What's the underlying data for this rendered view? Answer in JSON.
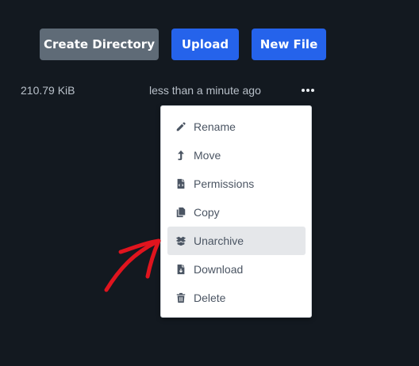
{
  "toolbar": {
    "create_directory": "Create Directory",
    "upload": "Upload",
    "new_file": "New File"
  },
  "file_row": {
    "size": "210.79 KiB",
    "modified": "less than a minute ago"
  },
  "context_menu": {
    "items": [
      {
        "label": "Rename",
        "icon": "pencil-icon"
      },
      {
        "label": "Move",
        "icon": "level-up-icon"
      },
      {
        "label": "Permissions",
        "icon": "file-code-icon"
      },
      {
        "label": "Copy",
        "icon": "copy-icon"
      },
      {
        "label": "Unarchive",
        "icon": "box-open-icon",
        "highlighted": true
      },
      {
        "label": "Download",
        "icon": "file-download-icon"
      },
      {
        "label": "Delete",
        "icon": "trash-icon"
      }
    ]
  },
  "colors": {
    "background": "#131920",
    "secondary_button": "#5f6b77",
    "primary_button": "#2563eb",
    "annotation_arrow": "#e0141e"
  }
}
